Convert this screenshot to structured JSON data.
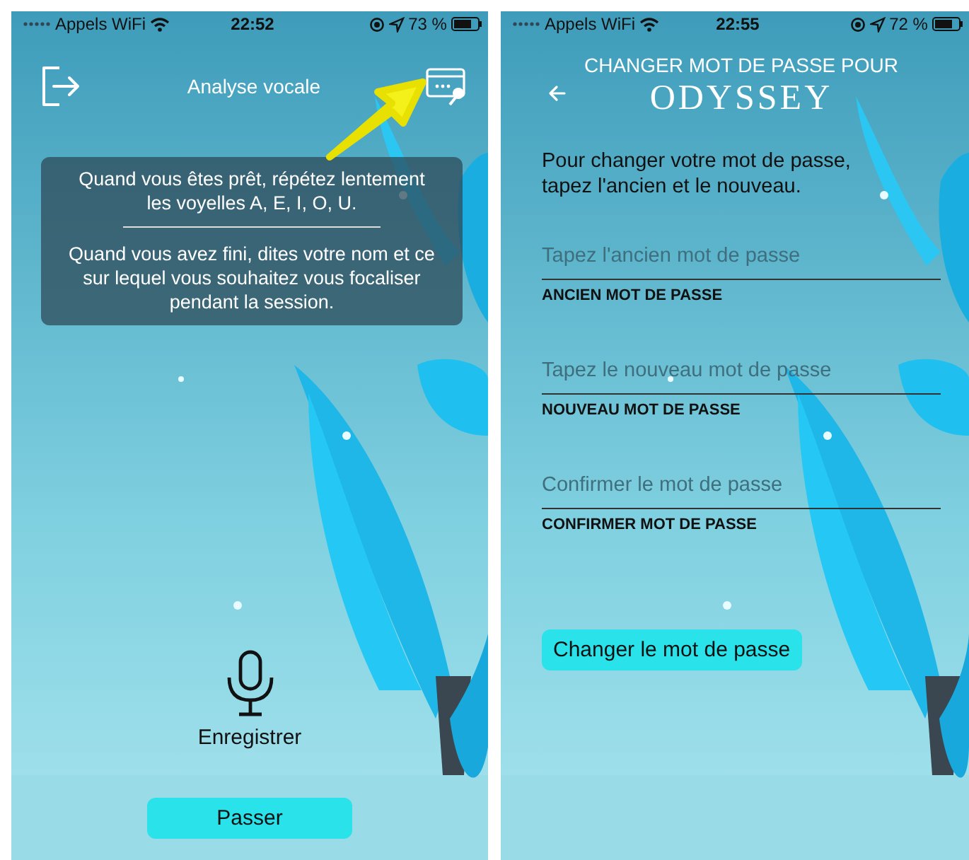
{
  "voice_screen": {
    "status_bar": {
      "carrier": "Appels WiFi",
      "time": "22:52",
      "battery": "73 %"
    },
    "title": "Analyse vocale",
    "message": [
      "Quand vous êtes prêt, répétez lentement les voyelles A, E, I, O, U.",
      "Quand vous avez fini, dites votre nom et ce sur lequel vous souhaitez vous focaliser pendant la session."
    ],
    "record_label": "Enregistrer",
    "skip_button": "Passer"
  },
  "password_screen": {
    "status_bar": {
      "carrier": "Appels WiFi",
      "time": "22:55",
      "battery": "72 %"
    },
    "title": "CHANGER MOT DE PASSE POUR",
    "account": "ODYSSEY",
    "instructions": "Pour changer votre mot de passe, tapez l'ancien et le nouveau.",
    "fields": [
      {
        "placeholder": "Tapez l'ancien mot de passe",
        "label": "ANCIEN MOT DE PASSE"
      },
      {
        "placeholder": "Tapez le nouveau mot de passe",
        "label": "NOUVEAU MOT DE PASSE"
      },
      {
        "placeholder": "Confirmer le mot de passe",
        "label": "CONFIRMER MOT DE PASSE"
      }
    ],
    "submit_button": "Changer le mot de passe"
  }
}
